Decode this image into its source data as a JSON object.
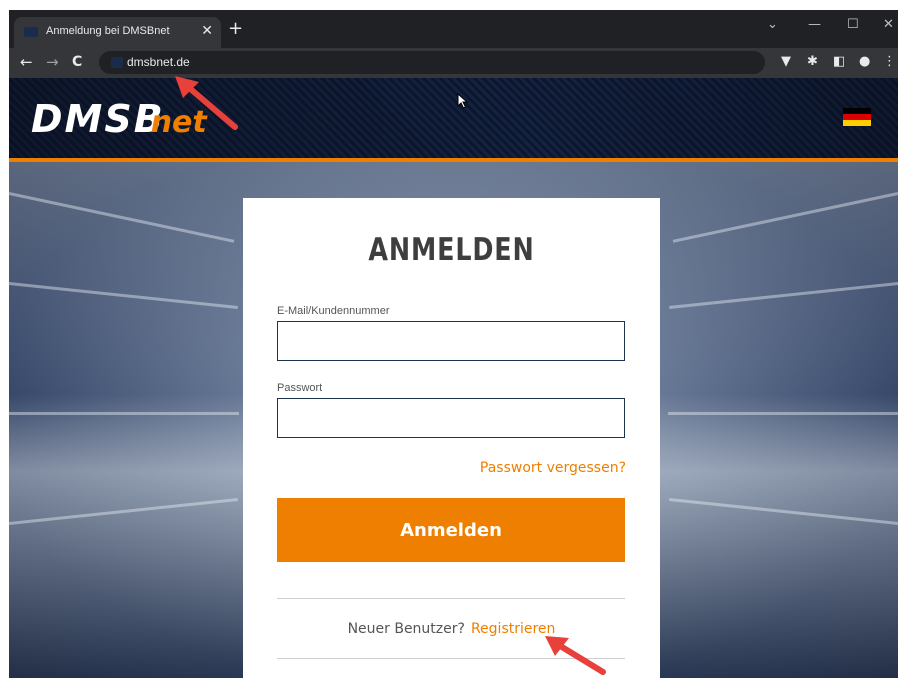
{
  "browser": {
    "tab_title": "Anmeldung bei DMSBnet",
    "tab_close": "✕",
    "new_tab": "+",
    "url": "dmsbnet.de",
    "window_controls": {
      "dropdown": "⌄",
      "minimize": "—",
      "maximize": "☐",
      "close": "✕"
    },
    "nav": {
      "back": "←",
      "forward": "→",
      "reload": "C"
    },
    "extensions": {
      "vivaldi": "▼",
      "puzzle": "✱",
      "sidepanel": "◧",
      "profile": "●",
      "menu": "⋮"
    }
  },
  "site": {
    "logo_main": "DMSB",
    "logo_suffix": "net",
    "flag_colors": [
      "#000000",
      "#dd0000",
      "#ffce00"
    ]
  },
  "login": {
    "title": "ANMELDEN",
    "email_label": "E-Mail/Kundennummer",
    "email_value": "",
    "password_label": "Passwort",
    "password_value": "",
    "forgot_link": "Passwort vergessen?",
    "submit_label": "Anmelden",
    "new_user_text": "Neuer Benutzer?",
    "register_link": "Registrieren"
  },
  "colors": {
    "accent": "#ee7f00",
    "annotation_arrow": "#e8403a"
  }
}
